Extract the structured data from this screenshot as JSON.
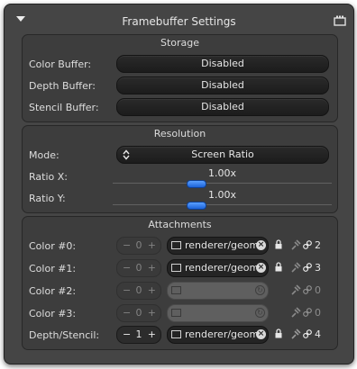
{
  "node": {
    "title": "Framebuffer Settings",
    "icons": {
      "collapse": "collapse-triangle-icon",
      "node": "framebuffer-node-icon"
    }
  },
  "storage": {
    "title": "Storage",
    "rows": [
      {
        "label": "Color Buffer:",
        "value": "Disabled"
      },
      {
        "label": "Depth Buffer:",
        "value": "Disabled"
      },
      {
        "label": "Stencil Buffer:",
        "value": "Disabled"
      }
    ]
  },
  "resolution": {
    "title": "Resolution",
    "mode": {
      "label": "Mode:",
      "value": "Screen Ratio"
    },
    "ratio_x": {
      "label": "Ratio X:",
      "value": "1.00x",
      "fraction": 0.37
    },
    "ratio_y": {
      "label": "Ratio Y:",
      "value": "1.00x",
      "fraction": 0.37
    }
  },
  "attachments": {
    "title": "Attachments",
    "rows": [
      {
        "label": "Color #0:",
        "index": "0",
        "texture": "renderer/geom",
        "count": "2",
        "linked": true,
        "active": false
      },
      {
        "label": "Color #1:",
        "index": "0",
        "texture": "renderer/geom",
        "count": "3",
        "linked": true,
        "active": false
      },
      {
        "label": "Color #2:",
        "index": "0",
        "texture": "",
        "count": "0",
        "linked": false,
        "active": false
      },
      {
        "label": "Color #3:",
        "index": "0",
        "texture": "",
        "count": "0",
        "linked": false,
        "active": false
      },
      {
        "label": "Depth/Stencil:",
        "index": "1",
        "texture": "renderer/geom",
        "count": "4",
        "linked": true,
        "active": true
      }
    ]
  },
  "colors": {
    "accent": "#2d6fe0",
    "panel": "#3d3d3d",
    "node": "#454545"
  }
}
